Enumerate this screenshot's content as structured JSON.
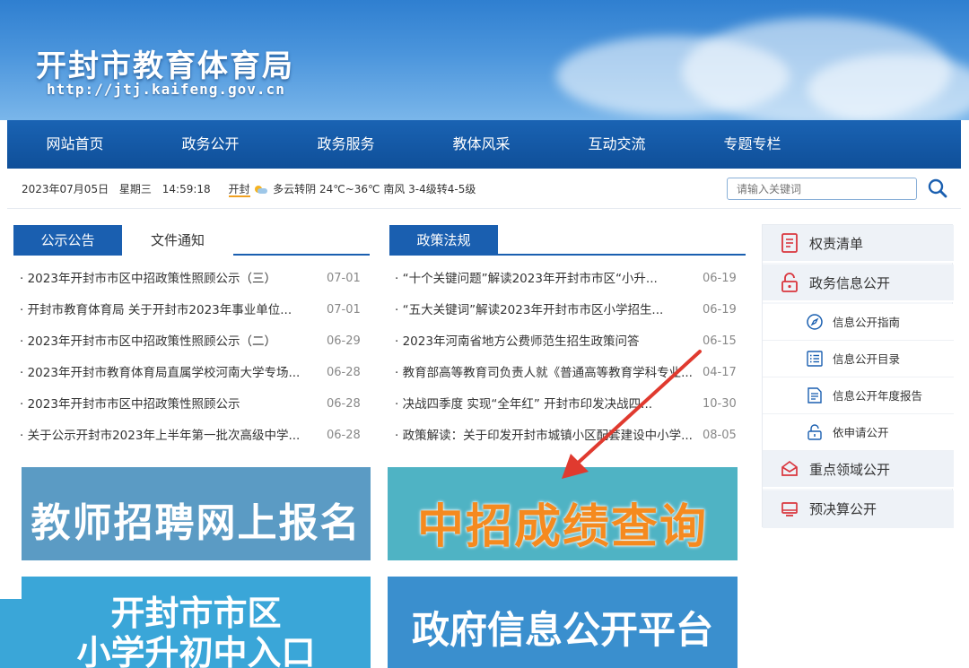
{
  "header": {
    "title": "开封市教育体育局",
    "url": "http://jtj.kaifeng.gov.cn"
  },
  "nav": {
    "items": [
      "网站首页",
      "政务公开",
      "政务服务",
      "教体风采",
      "互动交流",
      "专题专栏"
    ]
  },
  "infobar": {
    "date": "2023年07月05日",
    "weekday": "星期三",
    "time": "14:59:18",
    "city": "开封",
    "weather": "多云转阴 24℃~36℃ 南风 3-4级转4-5级",
    "search_placeholder": "请输入关键词",
    "icons": [
      "weather-icon",
      "search-icon"
    ]
  },
  "left_panel": {
    "tabs": [
      "公示公告",
      "文件通知"
    ],
    "items": [
      {
        "title": "2023年开封市市区中招政策性照顾公示（三）",
        "date": "07-01"
      },
      {
        "title": "开封市教育体育局 关于开封市2023年事业单位...",
        "date": "07-01"
      },
      {
        "title": "2023年开封市市区中招政策性照顾公示（二）",
        "date": "06-29"
      },
      {
        "title": "2023年开封市教育体育局直属学校河南大学专场...",
        "date": "06-28"
      },
      {
        "title": "2023年开封市市区中招政策性照顾公示",
        "date": "06-28"
      },
      {
        "title": "关于公示开封市2023年上半年第一批次高级中学...",
        "date": "06-28"
      }
    ]
  },
  "mid_panel": {
    "tabs": [
      "政策法规"
    ],
    "items": [
      {
        "title": "“十个关键问题”解读2023年开封市市区“小升...",
        "date": "06-19"
      },
      {
        "title": "“五大关键词”解读2023年开封市市区小学招生...",
        "date": "06-19"
      },
      {
        "title": "2023年河南省地方公费师范生招生政策问答",
        "date": "06-15"
      },
      {
        "title": "教育部高等教育司负责人就《普通高等教育学科专业...",
        "date": "04-17"
      },
      {
        "title": "决战四季度 实现“全年红” 开封市印发决战四...",
        "date": "10-30"
      },
      {
        "title": "政策解读：关于印发开封市城镇小区配套建设中小学...",
        "date": "08-05"
      }
    ]
  },
  "sidebar": {
    "items": [
      {
        "label": "权责清单",
        "icon": "list-document-icon",
        "level": "main"
      },
      {
        "label": "政务信息公开",
        "icon": "open-lock-icon",
        "level": "main"
      },
      {
        "label": "信息公开指南",
        "icon": "compass-icon",
        "level": "sub"
      },
      {
        "label": "信息公开目录",
        "icon": "list-icon",
        "level": "sub"
      },
      {
        "label": "信息公开年度报告",
        "icon": "report-icon",
        "level": "sub"
      },
      {
        "label": "依申请公开",
        "icon": "lock-icon",
        "level": "sub"
      },
      {
        "label": "重点领域公开",
        "icon": "envelope-icon",
        "level": "main"
      },
      {
        "label": "预决算公开",
        "icon": "monitor-icon",
        "level": "main"
      }
    ]
  },
  "banners": {
    "teacher_recruit": "教师招聘网上报名",
    "exam_score": "中招成绩查询",
    "primary_line1": "开封市市区",
    "primary_line2": "小学升初中入口",
    "gov_info": "政府信息公开平台"
  },
  "colors": {
    "nav_blue": "#0f4f99",
    "tab_blue": "#1a5fb0",
    "banner_gray_blue": "#5b9bc4",
    "banner_teal": "#4fb3c4",
    "banner_light_blue": "#3aa6d8",
    "banner_blue": "#3a8fce",
    "score_orange": "#f58a1f",
    "arrow_red": "#e03a2f",
    "icon_red": "#d9363e"
  }
}
